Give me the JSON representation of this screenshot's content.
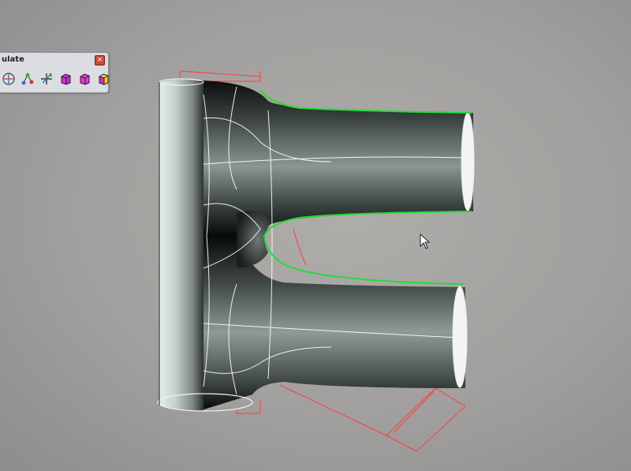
{
  "toolbar": {
    "title": "ulate",
    "icons": [
      "axis-sphere-icon",
      "node-graph-icon",
      "star-axis-icon",
      "cube-magenta-icon",
      "cube-magenta-2-icon",
      "cube-yellow-icon"
    ]
  },
  "viewport": {
    "object": "tee-pipe-surface",
    "edge_highlight_color": "#22dd33",
    "guide_curve_color": "#ff3b3b",
    "isoparm_color": "#ffffff"
  }
}
